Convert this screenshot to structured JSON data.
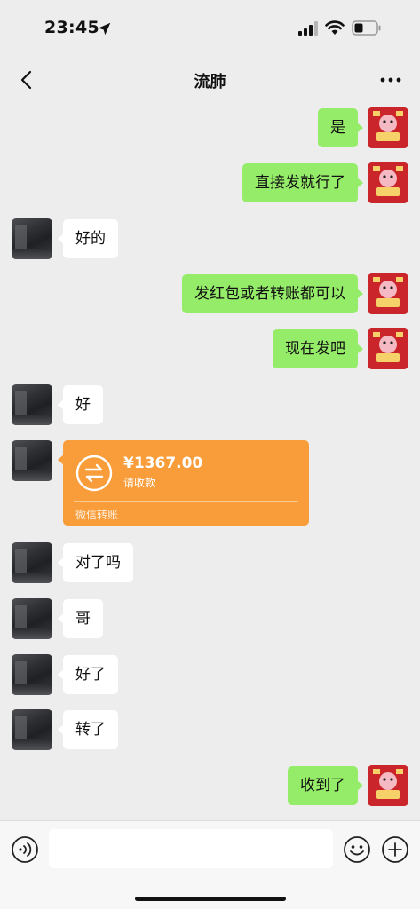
{
  "status_bar": {
    "time": "23:45"
  },
  "header": {
    "title": "流肺"
  },
  "messages": [
    {
      "from": "me",
      "text": "是"
    },
    {
      "from": "me",
      "text": "直接发就行了"
    },
    {
      "from": "peer",
      "text": "好的"
    },
    {
      "from": "me",
      "text": "发红包或者转账都可以"
    },
    {
      "from": "me",
      "text": "现在发吧"
    },
    {
      "from": "peer",
      "text": "好"
    },
    {
      "from": "peer",
      "type": "transfer",
      "amount": "¥1367.00",
      "status": "请收款",
      "footer": "微信转账"
    },
    {
      "from": "peer",
      "text": "对了吗"
    },
    {
      "from": "peer",
      "text": "哥"
    },
    {
      "from": "peer",
      "text": "好了"
    },
    {
      "from": "peer",
      "text": "转了"
    },
    {
      "from": "me",
      "text": "收到了"
    }
  ],
  "input_bar": {
    "placeholder": ""
  },
  "colors": {
    "background": "#ededed",
    "bubble_self": "#95ec69",
    "bubble_peer": "#ffffff",
    "transfer_card": "#f99d3a",
    "avatar_self": "#c9252b"
  },
  "icons": {
    "status_location": "location-arrow-icon",
    "signal": "cellular-signal-icon",
    "wifi": "wifi-icon",
    "battery": "battery-icon",
    "back": "chevron-left-icon",
    "more": "more-dots-icon",
    "voice": "voice-icon",
    "emoji": "emoji-icon",
    "plus": "plus-icon",
    "transfer": "transfer-arrows-icon"
  }
}
